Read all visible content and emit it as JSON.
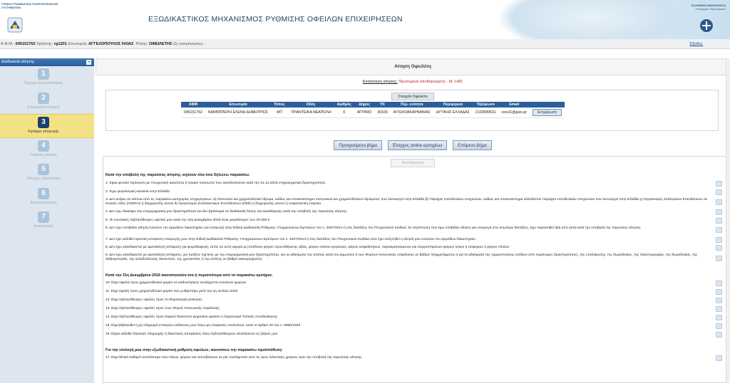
{
  "header": {
    "gsis_text": "ΓΕΝΙΚΗ ΓΡΑΜΜΑΤΕΙΑ ΠΛΗΡΟΦΟΡΙΑΚΩΝ ΣΥΣΤΗΜΑΤΩΝ",
    "title": "ΕΞΩΔΙΚΑΣΤΙΚΟΣ ΜΗΧΑΝΙΣΜΟΣ ΡΥΘΜΙΣΗΣ ΟΦΕΙΛΩΝ ΕΠΙΧΕΙΡΗΣΕΩΝ",
    "gov_text_1": "ΕΛΛΗΝΙΚΗ ΔΗΜΟΚΡΑΤΙΑ",
    "gov_text_2": "Υπουργείο Οικονομικών"
  },
  "infobar": {
    "afm_label": "Α.Φ.Μ.:",
    "afm": "045151762",
    "user_label": "Χρήστης:",
    "user": "rg1201",
    "name_label": "Επωνυμία:",
    "name": "ΑΓΓΕΛΟΠΟΥΛΟΣ ΗΛΙΑΣ",
    "role_label": "Ρόλος:",
    "role": "ΟΦΕΙΛΕΤΗΣ",
    "role_extra": "Ως εκπρόσωπος: -",
    "exit": "Έξοδος"
  },
  "sidebar": {
    "header": "Διαδικασία αίτησης",
    "steps": [
      {
        "num": "1",
        "label": "Παροχή εξουσιοδότησης"
      },
      {
        "num": "2",
        "label": "Επιλεγμένα στοιχεία"
      },
      {
        "num": "3",
        "label": "Κριτήρια υπαγωγής"
      },
      {
        "num": "4",
        "label": "Υποβολή αίτησης"
      },
      {
        "num": "5",
        "label": "Έλεγχος πληρότητας"
      },
      {
        "num": "6",
        "label": "Διαπραγμάτευση"
      },
      {
        "num": "7",
        "label": "Αποτέλεσμα"
      }
    ]
  },
  "main": {
    "title": "Αίτηση Οφειλέτη",
    "status_label": "Κατάσταση αίτησης:",
    "status_value": "Προσωρινά αποθηκευμένη - Id: 1481",
    "debtor_tab": "Στοιχεία Οφειλέτη",
    "debtor_headers": [
      "ΑΦΜ",
      "Επωνυμία",
      "Τύπος",
      "Οδός",
      "Αριθμός",
      "Δήμος",
      "ΤΚ",
      "Περ. ενότητα",
      "Περιφέρεια",
      "Τηλέφωνο",
      "Email",
      ""
    ],
    "debtor_row": [
      "045151762",
      "ΚΑΡΑΠΙΠΕΡΗ ΕΛΕΝΗ ΔΗΜΗΤΡΙΟΣ",
      "ΦΠ",
      "ΤΡΙΑΝΤΕΙΚΑ ΝΕΑΠΟΛΗ",
      "0",
      "ΑΓΡΙΝΙΟ",
      "30100",
      "ΑΙΤΩΛΟΑΚΑΡΝΑΝΙΑΣ",
      "ΔΥΤΙΚΗΣ ΕΛΛΑΔΑΣ",
      "2102589631",
      "ocw11@gsis.gr"
    ],
    "update_btn": "Ενημέρωση",
    "btn_prev": "Προηγούμενο βήμα",
    "btn_check": "Έλεγχος online κριτηρίων",
    "btn_next": "Επόμενο βήμα",
    "btn_save": "Αποθήκευση",
    "sec1": "Κατά την υποβολή της παρούσας αίτησης ισχύουν όλα όσα δηλώνω παρακάτω:",
    "sec2": "Κατά την 31η Δεκεμβρίου 2016 ικανοποιούσα ένα ή περισσότερα από τα παρακάτω κριτήρια:",
    "sec3": "Για την επιλογή μου στην εξωδικαστική ρύθμιση οφειλών, ικανοποιώ την παρακάτω προϋπόθεση:",
    "decl": [
      "1. Είμαι φυσικό πρόσωπο με πτωχευτική ικανότητα ή νομικό πρόσωπο που ασκεί/ασκούσε κατά την 31.12.2016 επιχειρηματική δραστηριότητα",
      "2. Έχω φορολογική κατοικία στην Ελλάδα",
      "3. Δεν ανήκω σε κάποια από τις παρακάτω κατηγορίες επιχειρήσεων: α) Πιστωτικό και χρηματοδοτικό ίδρυμα, καθώς και υποκατάστημα πιστωτικού και χρηματοδοτικού ιδρύματος που λειτουργεί στην Ελλάδα β) Πάροχος επενδυτικών υπηρεσιών, καθώς και υποκατάστημα αλλοδαπού παρόχου επενδυτικών υπηρεσιών που λειτουργεί στην Ελλάδα γ) Οργανισμός Συλλογικών Επενδύσεων σε Κινητές Αξίες (ΟΣΕΚΑ) ή διαχειριστής αυτού δ) Οργανισμός Εναλλακτικών Επενδύσεων (ΟΕΕ) ή διαχειριστής αυτού ε) Ασφαλιστική εταιρεία",
      "4. Δεν έχω διακόψει την επιχειρηματική μου δραστηριότητα και δεν βρίσκομαι σε διαδικασία λύσης και εκκαθάρισης κατά την υποβολή της παρούσας αίτησης",
      "5. Οι συνολικές ληξιπρόθεσμες οφειλές μου κατά την 31η Δεκεμβρίου 2016 είναι μεγαλύτερες των 20.000 €",
      "6. Δεν έχω υποβάλει αίτηση ενώπιον του αρμόδιου δικαστηρίου για υπαγωγή στην Ειδική Διαδικασία Ρύθμισης Υποχρεώσεων Εμπόρων του ν. 4307/2014 ή στις διατάξεις του Πτωχευτικού Κώδικα. Σε περίπτωση που έχω υποβάλει αίτηση για υπαγωγή στις ανωτέρω διατάξεις, έχω παραιτηθεί ήδη από αυτή κατά την υποβολή της παρούσας αίτησης",
      "7. Δεν έχει εκδοθεί οριστική απόφαση υπαγωγής μου στην Ειδική Διαδικασία Ρύθμισης Υποχρεώσεων Εμπόρων του ν. 4307/2014 ή στις διατάξεις του Πτωχευτικού Κώδικα ούτε έχει συζητηθεί η αίτησή μου ενώπιον του αρμόδιου δικαστηρίου",
      "8. Δεν έχω καταδικαστεί με αμετάκλητη απόφαση για φοροδιαφυγή, εκτός αν αυτή αφορά μη απόδοση φόρου προστιθέμενης αξίας, φόρου κύκλου εργασιών, φόρου ασφαλίστρων, παρακρατούμενων και επιρριπτόμενων φόρων τελών ή εισφορών ή φόρου πλοίων",
      "9. Δεν έχω καταδικαστεί με αμετάκλητη απόφαση, για πράξεις σχετικές με την επιχειρηματική μου δραστηριότητα, για τα αδικήματα της απάτης κατά του Δημοσίου ή των Φορέων Κοινωνικής Ασφάλισης σε βαθμό πλημμελήματος ή για τα αδικήματα της νομιμοποίησης εσόδων από παράνομες δραστηριότητες, της υπεξαίρεσης, της δωροδοκίας, της πλαστογραφίας, της δωροδοκίας, της λαθρεμπορίας, της καταδολίευσης δανειστών, της χρεοκοπίας ή της απάτης σε βαθμό κακουργήματος",
      "10. Είχα οφειλή προς χρηματοδοτικό φορέα σε καθυστέρηση τουλάχιστον ενενήντα ημερών",
      "11. Είχα οφειλή προς χρηματοδοτικό φορέα που ρυθμίστηκε μετά την 1η Ιουλίου 2016",
      "12. Είχα ληξιπρόθεσμες οφειλές προς τη Φορολογική Διοίκηση",
      "13. Είχα ληξιπρόθεσμες οφειλές προς τους Φορείς Κοινωνικής Ασφάλισης",
      "14. Είχα ληξιπρόθεσμες οφειλές προς Νομικό Πρόσωπο Δημοσίου Δικαίου ή Οργανισμό Τοπικής Αυτοδιοίκησης",
      "15. Είχα βεβαιωθεί ή μη πληρωμή επιταγών εκδόσεώς μου λόγω μη επαρκούς υπολοίπου, κατά το άρθρο 40 του ν. 5960/1933",
      "16. Είχαν εκδοθεί διαταγές πληρωμής ή δικαστικές αποφάσεις λόγω ληξιπρόθεσμων απαιτήσεων εις βάρος μου",
      "17. Είχα θετικό καθαρό αποτέλεσμα προ τόκων, φόρων και αποσβέσεων σε μία τουλάχιστον από τις τρεις τελευταίες χρήσεις πριν την υποβολή της παρούσας αίτησης"
    ]
  }
}
